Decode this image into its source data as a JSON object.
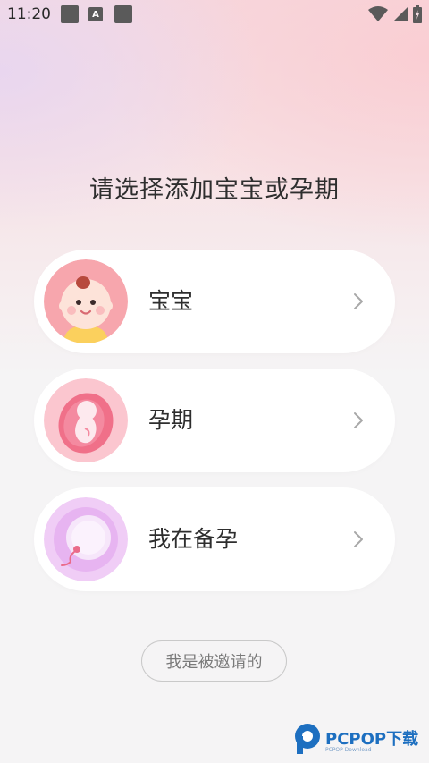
{
  "status_bar": {
    "time": "11:20",
    "notif_a_label": "A"
  },
  "page": {
    "title": "请选择添加宝宝或孕期"
  },
  "options": [
    {
      "label": "宝宝",
      "icon": "baby-face-icon"
    },
    {
      "label": "孕期",
      "icon": "fetus-icon"
    },
    {
      "label": "我在备孕",
      "icon": "egg-sperm-icon"
    }
  ],
  "invite_button": {
    "label": "我是被邀请的"
  },
  "watermark": {
    "brand": "PCPOP下载",
    "sub": "PCPOP Download"
  },
  "colors": {
    "accent_pink": "#f28b9b",
    "fetus_pink": "#f06b86",
    "egg_purple": "#e7b4f1",
    "text_dark": "#2e2e2e"
  }
}
